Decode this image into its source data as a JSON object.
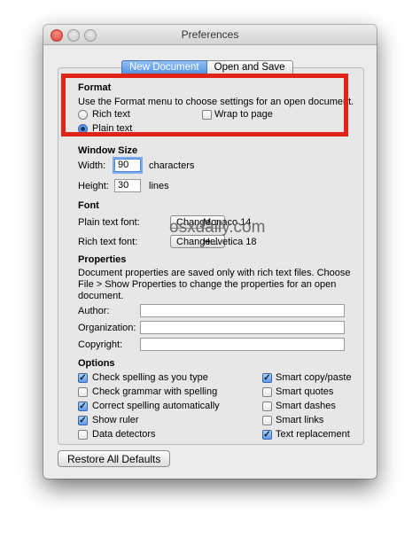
{
  "window": {
    "title": "Preferences"
  },
  "tabs": [
    {
      "label": "New Document",
      "active": true
    },
    {
      "label": "Open and Save",
      "active": false
    }
  ],
  "format": {
    "heading": "Format",
    "description": "Use the Format menu to choose settings for an open document.",
    "rich_text": "Rich text",
    "plain_text": "Plain text",
    "selected": "Plain text",
    "wrap_to_page": "Wrap to page",
    "wrap_checked": false
  },
  "window_size": {
    "heading": "Window Size",
    "width_label": "Width:",
    "width_value": "90",
    "width_unit": "characters",
    "height_label": "Height:",
    "height_value": "30",
    "height_unit": "lines"
  },
  "watermark": "osxdaily.com",
  "font": {
    "heading": "Font",
    "plain_label": "Plain text font:",
    "plain_button": "Change...",
    "plain_value": "Monaco 14",
    "rich_label": "Rich text font:",
    "rich_button": "Change...",
    "rich_value": "Helvetica 18"
  },
  "properties": {
    "heading": "Properties",
    "description_1": "Document properties are saved only with rich text files. Choose",
    "description_2": "File > Show Properties to change the properties for an open",
    "description_3": "document.",
    "author_label": "Author:",
    "author_value": "",
    "organization_label": "Organization:",
    "organization_value": "",
    "copyright_label": "Copyright:",
    "copyright_value": ""
  },
  "options": {
    "heading": "Options",
    "left": [
      {
        "label": "Check spelling as you type",
        "checked": true
      },
      {
        "label": "Check grammar with spelling",
        "checked": false
      },
      {
        "label": "Correct spelling automatically",
        "checked": true
      },
      {
        "label": "Show ruler",
        "checked": true
      },
      {
        "label": "Data detectors",
        "checked": false
      }
    ],
    "right": [
      {
        "label": "Smart copy/paste",
        "checked": true
      },
      {
        "label": "Smart quotes",
        "checked": false
      },
      {
        "label": "Smart dashes",
        "checked": false
      },
      {
        "label": "Smart links",
        "checked": false
      },
      {
        "label": "Text replacement",
        "checked": true
      }
    ]
  },
  "footer": {
    "restore_button": "Restore All Defaults"
  },
  "colors": {
    "highlight_box": "#e02418",
    "accent": "#4f8fe3"
  }
}
